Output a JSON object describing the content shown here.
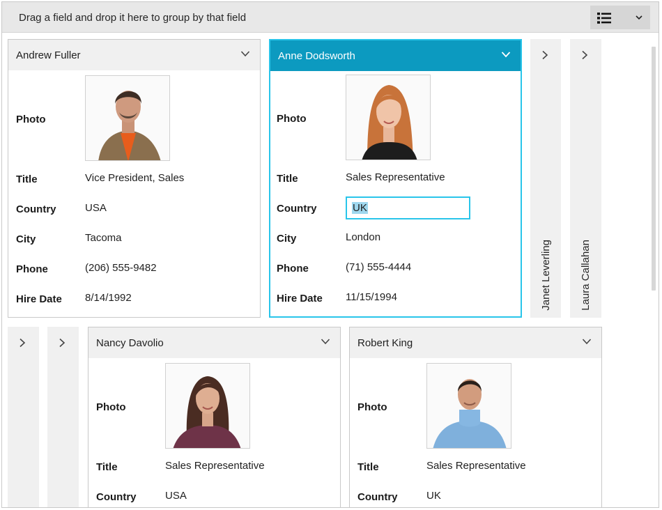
{
  "group_panel": {
    "hint": "Drag a field and drop it here to group by that field"
  },
  "view_button": {
    "icon": "list-view-icon",
    "dropdown_icon": "chevron-down-icon"
  },
  "field_labels": {
    "photo": "Photo",
    "title": "Title",
    "country": "Country",
    "city": "City",
    "phone": "Phone",
    "hire_date": "Hire Date"
  },
  "cards": {
    "andrew": {
      "name": "Andrew Fuller",
      "title": "Vice President, Sales",
      "country": "USA",
      "city": "Tacoma",
      "phone": "(206) 555-9482",
      "hire_date": "8/14/1992"
    },
    "anne": {
      "name": "Anne Dodsworth",
      "title": "Sales Representative",
      "country": "UK",
      "city": "London",
      "phone": "(71) 555-4444",
      "hire_date": "11/15/1994"
    },
    "nancy": {
      "name": "Nancy Davolio",
      "title": "Sales Representative",
      "country": "USA"
    },
    "robert": {
      "name": "Robert King",
      "title": "Sales Representative",
      "country": "UK"
    }
  },
  "collapsed_cards": {
    "janet": "Janet Leverling",
    "laura": "Laura Callahan"
  },
  "colors": {
    "selected_header": "#0c9ac0",
    "selected_border": "#29c5ea",
    "header_bg": "#f0f0f0"
  }
}
